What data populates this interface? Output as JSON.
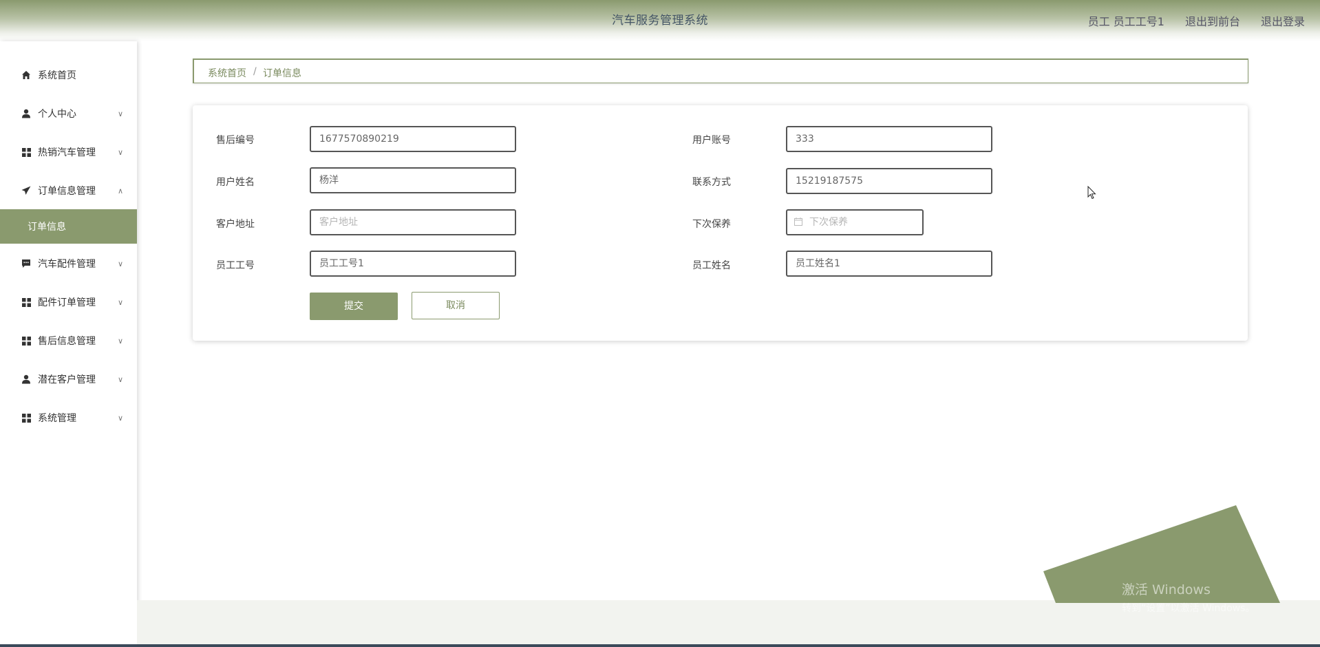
{
  "header": {
    "title": "汽车服务管理系统",
    "user": "员工 员工工号1",
    "back_to_front": "退出到前台",
    "logout": "退出登录"
  },
  "sidebar": {
    "items": [
      {
        "label": "系统首页",
        "icon": "home-icon"
      },
      {
        "label": "个人中心",
        "icon": "user-icon"
      },
      {
        "label": "热销汽车管理",
        "icon": "grid-icon"
      },
      {
        "label": "订单信息管理",
        "icon": "send-icon"
      },
      {
        "label": "汽车配件管理",
        "icon": "message-icon"
      },
      {
        "label": "配件订单管理",
        "icon": "grid-icon"
      },
      {
        "label": "售后信息管理",
        "icon": "grid-icon"
      },
      {
        "label": "潜在客户管理",
        "icon": "user-icon"
      },
      {
        "label": "系统管理",
        "icon": "grid-icon"
      }
    ],
    "active_sub": "订单信息"
  },
  "breadcrumb": {
    "home": "系统首页",
    "separator": "/",
    "current": "订单信息"
  },
  "form": {
    "after_sales_no": {
      "label": "售后编号",
      "value": "1677570890219"
    },
    "user_account": {
      "label": "用户账号",
      "value": "333"
    },
    "user_name": {
      "label": "用户姓名",
      "value": "杨洋"
    },
    "contact": {
      "label": "联系方式",
      "value": "15219187575"
    },
    "address": {
      "label": "客户地址",
      "placeholder": "客户地址"
    },
    "next_maintenance": {
      "label": "下次保养",
      "placeholder": "下次保养"
    },
    "employee_no": {
      "label": "员工工号",
      "value": "员工工号1"
    },
    "employee_name": {
      "label": "员工姓名",
      "value": "员工姓名1"
    },
    "submit": "提交",
    "cancel": "取消"
  },
  "watermark": {
    "line1": "激活 Windows",
    "line2": "转到“设置”以激活 Windows。"
  },
  "colors": {
    "accent": "#8a9a6e",
    "header_text": "#445566"
  }
}
